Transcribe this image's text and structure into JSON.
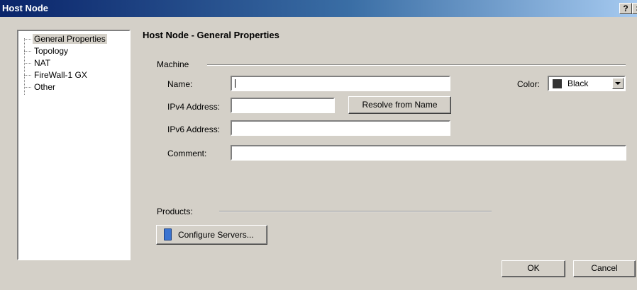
{
  "window": {
    "title": "Host Node",
    "help_label": "?",
    "close_label": "×"
  },
  "tree": {
    "items": [
      {
        "label": "General Properties",
        "selected": true
      },
      {
        "label": "Topology"
      },
      {
        "label": "NAT"
      },
      {
        "label": "FireWall-1 GX"
      },
      {
        "label": "Other"
      }
    ]
  },
  "main": {
    "heading": "Host Node - General Properties",
    "machine_group": "Machine",
    "name_label": "Name:",
    "name_value": "",
    "ipv4_label": "IPv4 Address:",
    "ipv4_value": "",
    "resolve_button": "Resolve from Name",
    "ipv6_label": "IPv6 Address:",
    "ipv6_value": "",
    "comment_label": "Comment:",
    "comment_value": "",
    "color_label": "Color:",
    "color_value": "Black",
    "color_swatch": "#333333",
    "products_label": "Products:",
    "configure_servers_button": "Configure Servers...",
    "configure_icon": "book-icon"
  },
  "footer": {
    "ok": "OK",
    "cancel": "Cancel"
  }
}
